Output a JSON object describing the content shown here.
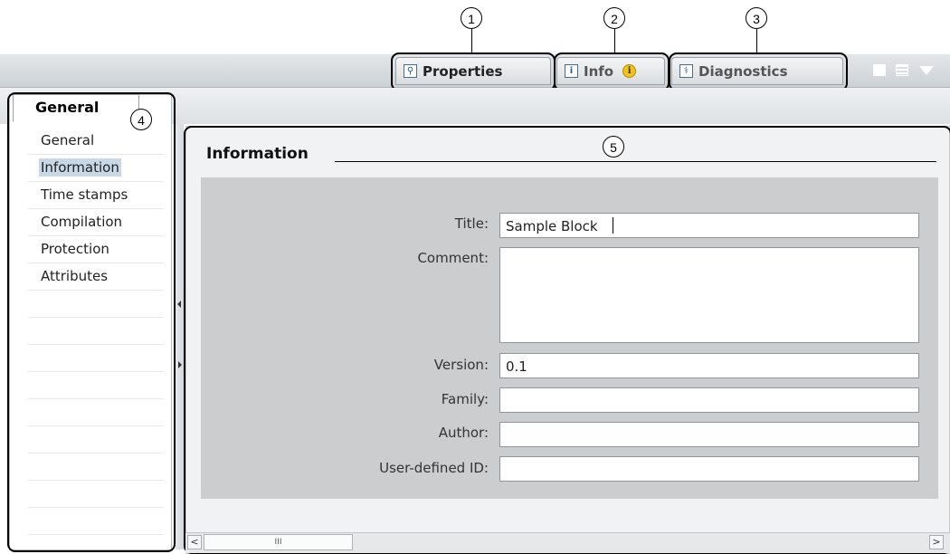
{
  "callouts": [
    "1",
    "2",
    "3",
    "4",
    "5"
  ],
  "tabs": {
    "properties": {
      "label": "Properties",
      "icon": "magnifier-properties-icon"
    },
    "info": {
      "label": "Info",
      "icon": "info-arrow-icon",
      "badge": "i"
    },
    "diagnostics": {
      "label": "Diagnostics",
      "icon": "diagnostics-icon"
    }
  },
  "window_controls": [
    "restore-icon",
    "list-icon",
    "dropdown-arrow-icon"
  ],
  "nav": {
    "tab_label": "General",
    "items": [
      "General",
      "Information",
      "Time stamps",
      "Compilation",
      "Protection",
      "Attributes"
    ],
    "selected": "Information"
  },
  "section": {
    "title": "Information"
  },
  "form": {
    "title": {
      "label": "Title:",
      "value": "Sample Block"
    },
    "comment": {
      "label": "Comment:",
      "value": ""
    },
    "version": {
      "label": "Version:",
      "value": "0.1"
    },
    "family": {
      "label": "Family:",
      "value": ""
    },
    "author": {
      "label": "Author:",
      "value": ""
    },
    "user_defined_id": {
      "label": "User-defined ID:",
      "value": ""
    }
  },
  "scrollbar": {
    "thumb_glyph": "III",
    "left": "<",
    "right": ">"
  },
  "colors": {
    "selected_item_bg": "#c9d8e6",
    "info_badge": "#f3c218"
  }
}
